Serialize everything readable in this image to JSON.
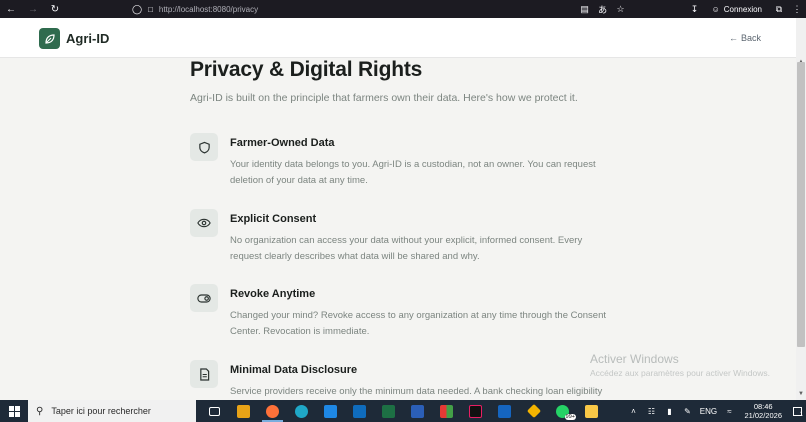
{
  "browser": {
    "url": "http://localhost:8080/privacy",
    "account_label": "Connexion"
  },
  "header": {
    "brand": "Agri-ID",
    "back_label": "Back"
  },
  "page": {
    "title": "Privacy & Digital Rights",
    "subtitle": "Agri-ID is built on the principle that farmers own their data. Here's how we protect it."
  },
  "items": [
    {
      "icon": "shield-icon",
      "title": "Farmer-Owned Data",
      "desc": "Your identity data belongs to you. Agri-ID is a custodian, not an owner. You can request deletion of your data at any time."
    },
    {
      "icon": "eye-icon",
      "title": "Explicit Consent",
      "desc": "No organization can access your data without your explicit, informed consent. Every request clearly describes what data will be shared and why."
    },
    {
      "icon": "toggle-icon",
      "title": "Revoke Anytime",
      "desc": "Changed your mind? Revoke access to any organization at any time through the Consent Center. Revocation is immediate."
    },
    {
      "icon": "document-icon",
      "title": "Minimal Data Disclosure",
      "desc": "Service providers receive only the minimum data needed. A bank checking loan eligibility"
    }
  ],
  "watermark": {
    "title": "Activer Windows",
    "subtitle": "Accédez aux paramètres pour activer Windows."
  },
  "taskbar": {
    "search_placeholder": "Taper ici pour rechercher",
    "language": "ENG",
    "time": "08:46",
    "date": "21/02/2026",
    "notification_count": "1",
    "whatsapp_badge": "99+"
  },
  "colors": {
    "brand_green": "#2f6b4e",
    "browser_chrome": "#1c1b22",
    "taskbar": "#1e2a38"
  }
}
